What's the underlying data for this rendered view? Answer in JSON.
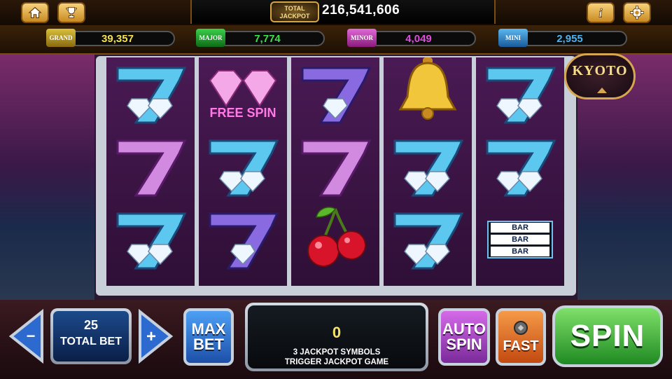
{
  "top_bar": {
    "home_icon": "home-icon",
    "trophy_icon": "trophy-icon",
    "info_icon": "info-icon",
    "settings_icon": "gear-icon"
  },
  "total_jackpot": {
    "badge_line1": "TOTAL",
    "badge_line2": "JACKPOT",
    "value": "216,541,606"
  },
  "jackpots": [
    {
      "label": "GRAND",
      "value": "39,357",
      "color": "#f5e24a"
    },
    {
      "label": "MAJOR",
      "value": "7,774",
      "color": "#3ee04a"
    },
    {
      "label": "MINOR",
      "value": "4,049",
      "color": "#e04ae0"
    },
    {
      "label": "MINI",
      "value": "2,955",
      "color": "#4ab2f0"
    }
  ],
  "theme_badge": "KYOTO",
  "reels": [
    [
      "seven-blue-diamond",
      "seven-pink",
      "seven-blue-diamond"
    ],
    [
      "free-spin-diamond",
      "seven-blue-diamond",
      "seven-purple-diamond"
    ],
    [
      "seven-purple-diamond",
      "seven-pink",
      "cherries"
    ],
    [
      "bell",
      "seven-blue-diamond",
      "seven-blue-diamond"
    ],
    [
      "seven-blue-diamond",
      "seven-blue-diamond",
      "triple-bar"
    ]
  ],
  "symbol_text": {
    "free_spin": "FREE SPIN",
    "bar": "BAR"
  },
  "controls": {
    "total_bet_value": "25",
    "total_bet_label": "TOTAL BET",
    "decrease_symbol": "−",
    "increase_symbol": "+",
    "max_bet_line1": "MAX",
    "max_bet_line2": "BET",
    "win_value": "0",
    "win_message_line1": "3 JACKPOT SYMBOLS",
    "win_message_line2": "TRIGGER JACKPOT GAME",
    "auto_spin_line1": "AUTO",
    "auto_spin_line2": "SPIN",
    "fast_label": "FAST",
    "spin_label": "SPIN"
  }
}
